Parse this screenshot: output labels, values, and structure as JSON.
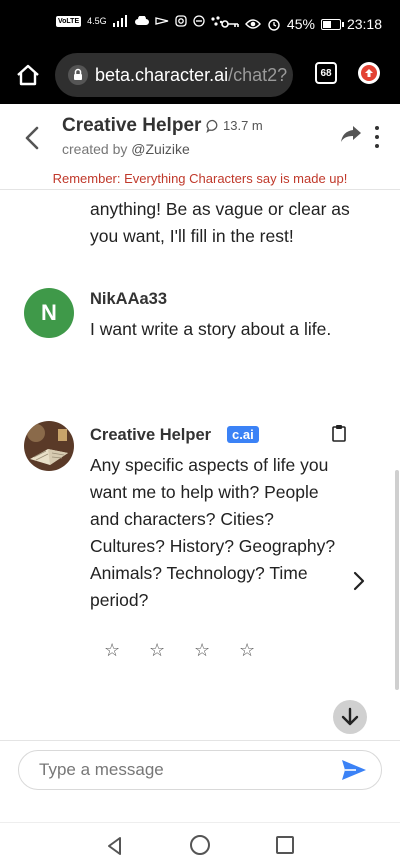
{
  "status_bar": {
    "volte": "VoLTE",
    "network": "4.5G",
    "battery": "45%",
    "battery_level": 0.45,
    "time": "23:18"
  },
  "browser": {
    "url_host": "beta.character.ai",
    "url_path": "/chat2?",
    "tab_count": "68"
  },
  "header": {
    "character_name": "Creative Helper",
    "interactions": "13.7 m",
    "created_by": "created by ",
    "creator_handle": "@Zuizike",
    "disclaimer": "Remember: Everything Characters say is made up!"
  },
  "chat": {
    "partial_message": "anything! Be as vague or clear as you want, I'll fill in the rest!",
    "messages": [
      {
        "initial": "N",
        "name": "NikAAa33",
        "text": "I want write a story about a life."
      },
      {
        "name": "Creative Helper",
        "badge": "c.ai",
        "text": "Any specific aspects of life you want me to help with? People and characters? Cities? Cultures? History? Geography? Animals? Technology? Time period?"
      }
    ],
    "rating_stars": [
      "☆",
      "☆",
      "☆",
      "☆"
    ]
  },
  "input": {
    "placeholder": "Type a message"
  },
  "colors": {
    "accent": "#3b82f6",
    "user_avatar": "#3f9949",
    "disclaimer": "#c0392b"
  },
  "icons": [
    "home-icon",
    "lock-icon",
    "tabs-icon",
    "update-icon",
    "back-arrow-icon",
    "chat-bubble-icon",
    "share-icon",
    "more-icon",
    "clipboard-icon",
    "chevron-right-icon",
    "arrow-down-icon",
    "send-icon"
  ]
}
